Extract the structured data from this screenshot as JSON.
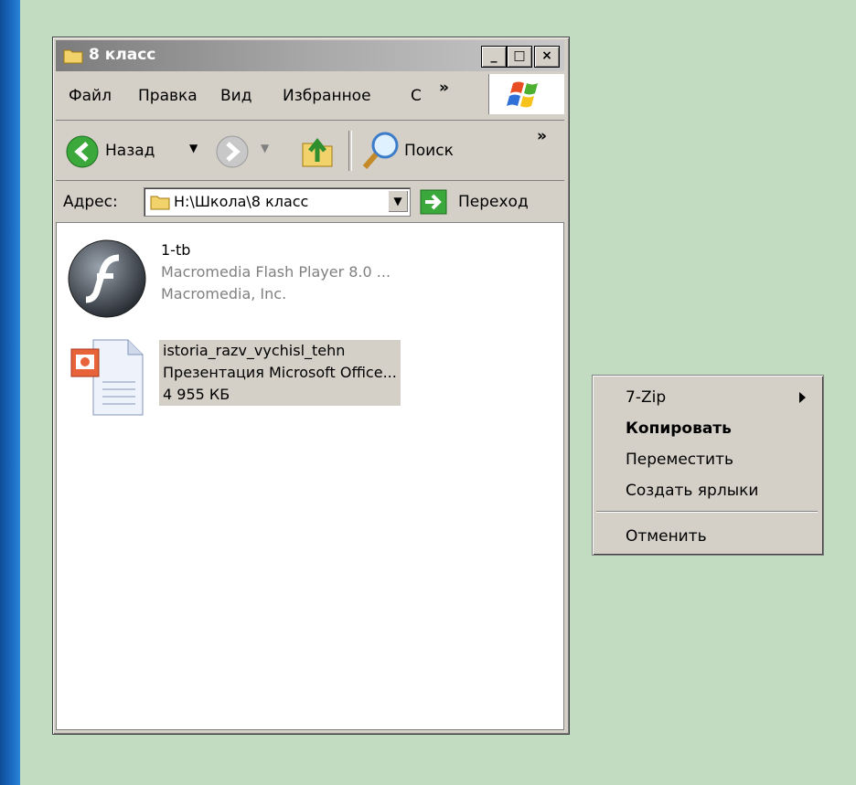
{
  "window": {
    "title": "8 класс",
    "min_symbol": "_",
    "max_symbol": "□",
    "close_symbol": "×"
  },
  "menubar": {
    "items": [
      "Файл",
      "Правка",
      "Вид",
      "Избранное",
      "С"
    ],
    "overflow": "»"
  },
  "toolbar": {
    "back_label": "Назад",
    "search_label": "Поиск",
    "overflow": "»",
    "dropdown_symbol": "▼"
  },
  "address": {
    "label": "Адрес:",
    "value": "H:\\Школа\\8 класс",
    "go_label": "Переход"
  },
  "files": [
    {
      "name": "1-tb",
      "type": "Macromedia Flash Player 8.0 ...",
      "meta": "Macromedia, Inc.",
      "icon": "flash-icon"
    },
    {
      "name": "istoria_razv_vychisl_tehn",
      "type": "Презентация Microsoft Office...",
      "meta": "4 955 КБ",
      "icon": "powerpoint-icon"
    }
  ],
  "context_menu": {
    "items": [
      "7-Zip",
      "Копировать",
      "Переместить",
      "Создать ярлыки",
      "Отменить"
    ]
  },
  "colors": {
    "desktop_bg": "#c1dcc1",
    "window_face": "#d4d0c8",
    "selection": "#d4d0c8"
  }
}
